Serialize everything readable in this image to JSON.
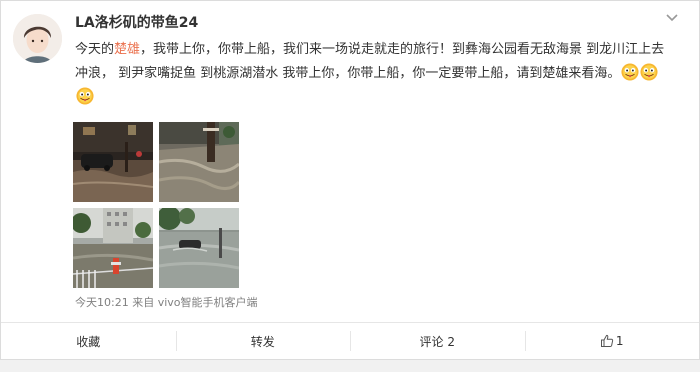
{
  "post": {
    "username": "LA洛杉矶的带鱼24",
    "text_before_topic": "今天的",
    "topic": "楚雄",
    "text_after_topic": "，我带上你，你带上船，我们来一场说走就走的旅行！到彝海公园看无敌海景 到龙川江上去冲浪， 到尹家嘴捉鱼 到桃源湖潜水 我带上你，你带上船，你一定要带上船，请到楚雄来看海。",
    "emoji_names": [
      "tongue-face-emoji",
      "tongue-face-emoji",
      "tongue-face-emoji"
    ],
    "meta": "今天10:21 来自 vivo智能手机客户端"
  },
  "photos": [
    {
      "name": "photo-flooded-street-night-car"
    },
    {
      "name": "photo-flooded-street-tree"
    },
    {
      "name": "photo-flooded-street-buildings"
    },
    {
      "name": "photo-flooded-road-car"
    }
  ],
  "actions": {
    "favorite": "收藏",
    "repost": "转发",
    "comment": "评论 2",
    "like_count": "1"
  },
  "colors": {
    "topic": "#eb7350",
    "meta": "#808080",
    "page_bg": "#f1f1f1"
  }
}
